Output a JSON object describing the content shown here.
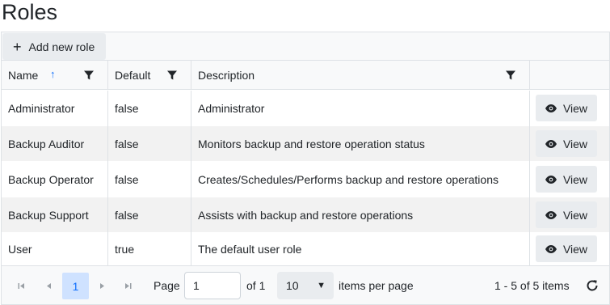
{
  "page": {
    "title": "Roles"
  },
  "toolbar": {
    "add_label": "Add new role"
  },
  "columns": [
    {
      "label": "Name",
      "sort": "ascending"
    },
    {
      "label": "Default"
    },
    {
      "label": "Description"
    }
  ],
  "rows": [
    {
      "name": "Administrator",
      "default": "false",
      "description": "Administrator",
      "action": "View"
    },
    {
      "name": "Backup Auditor",
      "default": "false",
      "description": "Monitors backup and restore operation status",
      "action": "View"
    },
    {
      "name": "Backup Operator",
      "default": "false",
      "description": "Creates/Schedules/Performs backup and restore operations",
      "action": "View"
    },
    {
      "name": "Backup Support",
      "default": "false",
      "description": "Assists with backup and restore operations",
      "action": "View"
    },
    {
      "name": "User",
      "default": "true",
      "description": "The default user role",
      "action": "View"
    }
  ],
  "pager": {
    "current_page": "1",
    "page_label": "Page",
    "page_input_value": "1",
    "of_label": "of 1",
    "page_size": "10",
    "items_per_page_label": "items per page",
    "summary": "1 - 5 of 5 items"
  },
  "colors": {
    "accent": "#0d6efd",
    "selected_bg": "#cfe2ff",
    "row_alt": "#f2f2f2"
  }
}
